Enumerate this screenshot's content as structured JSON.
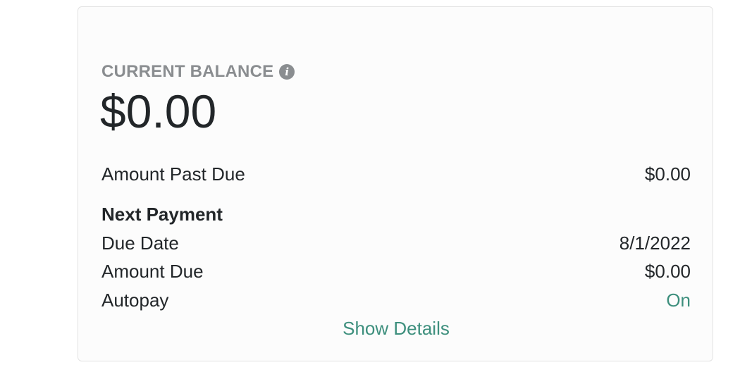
{
  "balance": {
    "heading": "CURRENT BALANCE",
    "info_icon": "info-icon",
    "amount": "$0.00"
  },
  "past_due": {
    "label": "Amount Past Due",
    "value": "$0.00"
  },
  "next_payment": {
    "heading": "Next Payment",
    "due_date_label": "Due Date",
    "due_date_value": "8/1/2022",
    "amount_due_label": "Amount Due",
    "amount_due_value": "$0.00",
    "autopay_label": "Autopay",
    "autopay_value": "On"
  },
  "show_details_label": "Show Details",
  "colors": {
    "accent": "#3d8f7d",
    "muted": "#8a8d90",
    "text": "#222629"
  }
}
